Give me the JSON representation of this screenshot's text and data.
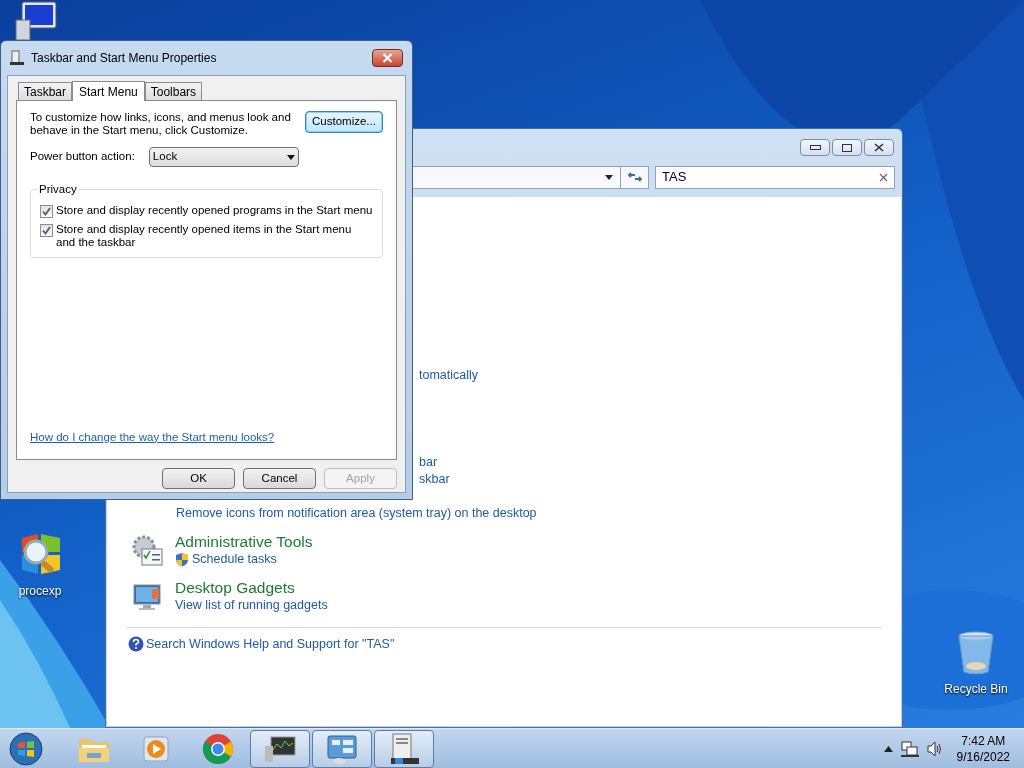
{
  "desktop_icons": [
    {
      "kind": "computer"
    },
    {
      "kind": "procexp",
      "label": "procexp"
    },
    {
      "kind": "recycle",
      "label": "Recycle Bin"
    }
  ],
  "control_panel": {
    "search_value": "TAS",
    "results": [
      {
        "kind": "fragment",
        "text": "tomatically"
      },
      {
        "kind": "fragment",
        "text": "bar"
      },
      {
        "kind": "fragment",
        "text": "skbar"
      },
      {
        "kind": "link",
        "text": "Remove icons from notification area (system tray) on the desktop"
      },
      {
        "kind": "group",
        "title": "Administrative Tools",
        "links": [
          {
            "text": "Schedule tasks",
            "shield": true
          }
        ]
      },
      {
        "kind": "group",
        "title": "Desktop Gadgets",
        "links": [
          {
            "text": "View list of running gadgets",
            "shield": false
          }
        ]
      }
    ],
    "help_link": "Search Windows Help and Support for \"TAS\""
  },
  "dialog": {
    "title": "Taskbar and Start Menu Properties",
    "tabs": [
      {
        "label": "Taskbar",
        "selected": false
      },
      {
        "label": "Start Menu",
        "selected": true
      },
      {
        "label": "Toolbars",
        "selected": false
      }
    ],
    "description": "To customize how links, icons, and menus look and behave in the Start menu, click Customize.",
    "customize_button": "Customize...",
    "power_label": "Power button action:",
    "power_value": "Lock",
    "privacy": {
      "title": "Privacy",
      "options": [
        {
          "label": "Store and display recently opened programs in the Start menu",
          "checked": true
        },
        {
          "label": "Store and display recently opened items in the Start menu and the taskbar",
          "checked": true
        }
      ]
    },
    "help_link": "How do I change the way the Start menu looks?",
    "buttons": [
      {
        "label": "OK",
        "disabled": false
      },
      {
        "label": "Cancel",
        "disabled": false
      },
      {
        "label": "Apply",
        "disabled": true
      }
    ]
  },
  "taskbar": {
    "apps": [
      {
        "kind": "folder",
        "running": false
      },
      {
        "kind": "media",
        "running": false
      },
      {
        "kind": "chrome",
        "running": false
      },
      {
        "kind": "monitor",
        "running": true
      },
      {
        "kind": "control",
        "running": true
      },
      {
        "kind": "properties",
        "running": true
      }
    ],
    "time": "7:42 AM",
    "date": "9/16/2022"
  }
}
